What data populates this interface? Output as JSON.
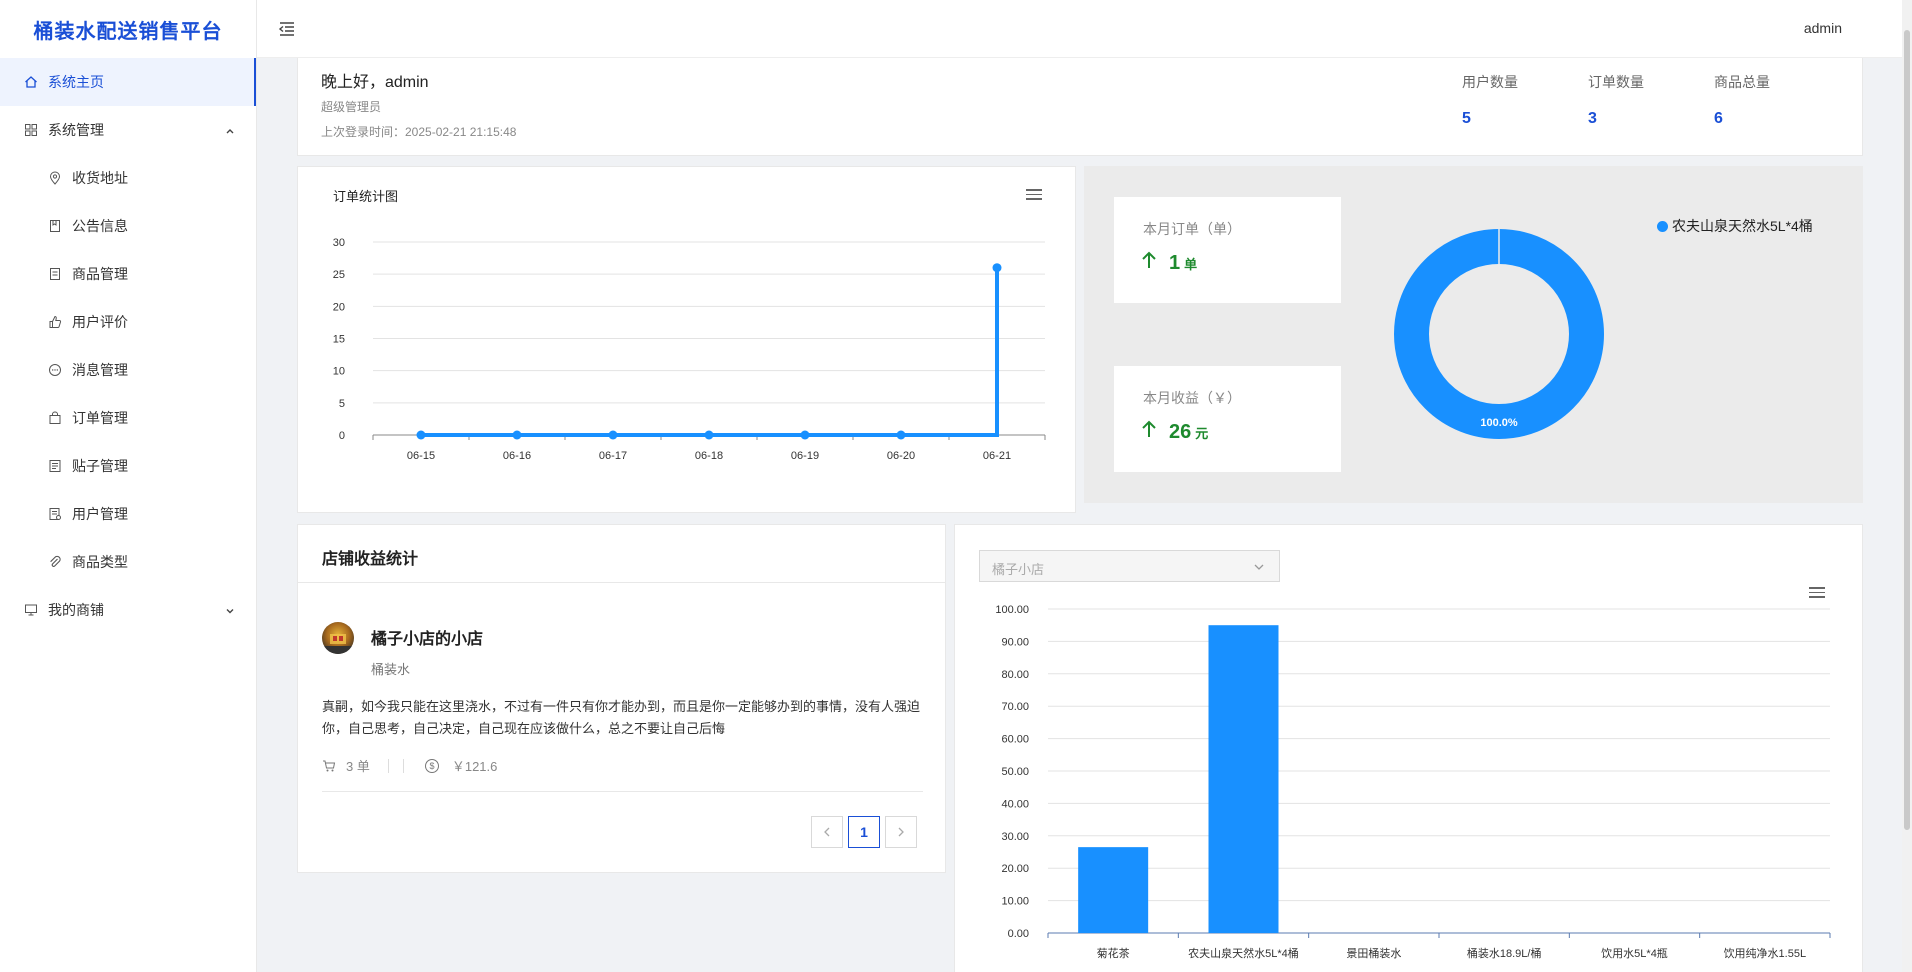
{
  "sidebar": {
    "logo": "桶装水配送销售平台",
    "items": [
      {
        "label": "系统主页",
        "icon": "home-icon"
      },
      {
        "label": "系统管理",
        "icon": "grid-icon"
      },
      {
        "label": "收货地址",
        "icon": "location-icon"
      },
      {
        "label": "公告信息",
        "icon": "bookmark-icon"
      },
      {
        "label": "商品管理",
        "icon": "product-icon"
      },
      {
        "label": "用户评价",
        "icon": "thumb-up-icon"
      },
      {
        "label": "消息管理",
        "icon": "message-icon"
      },
      {
        "label": "订单管理",
        "icon": "bag-icon"
      },
      {
        "label": "贴子管理",
        "icon": "post-icon"
      },
      {
        "label": "用户管理",
        "icon": "user-doc-icon"
      },
      {
        "label": "商品类型",
        "icon": "paperclip-icon"
      },
      {
        "label": "我的商铺",
        "icon": "monitor-icon"
      }
    ]
  },
  "header": {
    "user": "admin"
  },
  "greeting": {
    "hello": "晚上好，admin",
    "role": "超级管理员",
    "last_login": "上次登录时间：2025-02-21 21:15:48"
  },
  "stats": [
    {
      "label": "用户数量",
      "value": "5"
    },
    {
      "label": "订单数量",
      "value": "3"
    },
    {
      "label": "商品总量",
      "value": "6"
    }
  ],
  "order_chart_title": "订单统计图",
  "month": {
    "orders_label": "本月订单（单）",
    "orders_value": "1",
    "orders_unit": "单",
    "revenue_label": "本月收益（￥）",
    "revenue_value": "26",
    "revenue_unit": "元",
    "legend": "农夫山泉天然水5L*4桶",
    "pie_label": "100.0%"
  },
  "shop": {
    "title": "店铺收益统计",
    "name": "橘子小店的小店",
    "type": "桶装水",
    "desc": "真嗣，如今我只能在这里浇水，不过有一件只有你才能办到，而且是你一定能够办到的事情，没有人强迫你，自己思考，自己决定，自己现在应该做什么，总之不要让自己后悔",
    "orders": "3 单",
    "revenue": "￥121.6",
    "page": "1"
  },
  "bar_select": "橘子小店",
  "colors": {
    "primary": "#1a4fd6",
    "chart_blue": "#1890ff",
    "green": "#1e8a2e"
  },
  "chart_data": [
    {
      "type": "line",
      "title": "订单统计图",
      "x": [
        "06-15",
        "06-16",
        "06-17",
        "06-18",
        "06-19",
        "06-20",
        "06-21"
      ],
      "y": [
        0,
        0,
        0,
        0,
        0,
        0,
        26
      ],
      "ylim": [
        0,
        30
      ],
      "yticks": [
        "0",
        "5",
        "10",
        "15",
        "20",
        "25",
        "30"
      ],
      "grid": true
    },
    {
      "type": "pie",
      "labels": [
        "农夫山泉天然水5L*4桶"
      ],
      "values": [
        100
      ],
      "data_labels": [
        "100.0%"
      ],
      "legend": "top-right"
    },
    {
      "type": "bar",
      "categories": [
        "菊花茶",
        "农夫山泉天然水5L*4桶",
        "景田桶装水",
        "桶装水18.9L/桶",
        "饮用水5L*4瓶",
        "饮用纯净水1.55L"
      ],
      "values": [
        26.5,
        95,
        0,
        0,
        0,
        0
      ],
      "ylim": [
        0,
        100
      ],
      "yticks": [
        "0.00",
        "10.00",
        "20.00",
        "30.00",
        "40.00",
        "50.00",
        "60.00",
        "70.00",
        "80.00",
        "90.00",
        "100.00"
      ],
      "grid": true
    }
  ]
}
